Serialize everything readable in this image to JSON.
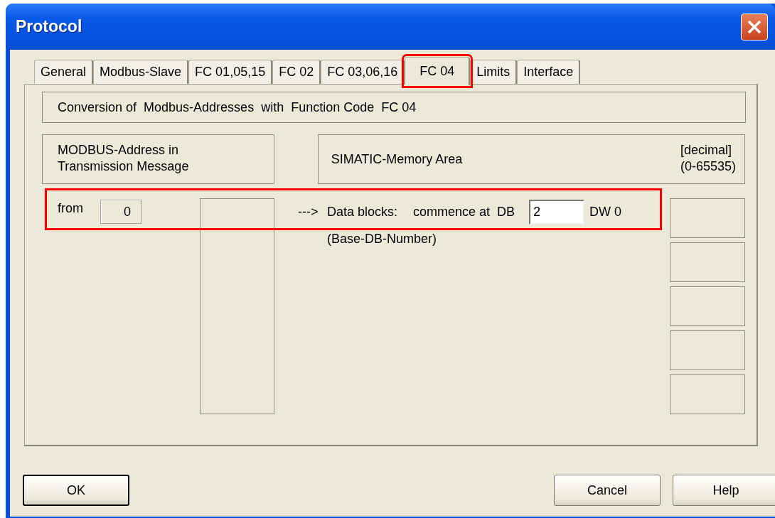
{
  "window": {
    "title": "Protocol"
  },
  "tabs": [
    {
      "label": "General",
      "selected": false
    },
    {
      "label": "Modbus-Slave",
      "selected": false
    },
    {
      "label": "FC 01,05,15",
      "selected": false
    },
    {
      "label": "FC 02",
      "selected": false
    },
    {
      "label": "FC 03,06,16",
      "selected": false
    },
    {
      "label": "FC 04",
      "selected": true
    },
    {
      "label": "Limits",
      "selected": false
    },
    {
      "label": "Interface",
      "selected": false
    }
  ],
  "header": "Conversion of  Modbus-Addresses  with  Function Code  FC 04",
  "left_heading": [
    "MODBUS-Address in",
    "Transmission Message"
  ],
  "right_heading": {
    "title": "SIMATIC-Memory Area",
    "unit": [
      "[decimal]",
      "(0-65535)"
    ]
  },
  "mapping": {
    "from_label": "from",
    "from_value": "0",
    "arrow": "--->",
    "target_label": "Data blocks:",
    "commence_label": "commence at  DB",
    "db_value": "2",
    "dw_label": "DW 0",
    "note": "(Base-DB-Number)"
  },
  "buttons": [
    {
      "label": "OK",
      "default": true
    },
    {
      "label": "Cancel",
      "default": false
    },
    {
      "label": "Help",
      "default": false
    }
  ]
}
